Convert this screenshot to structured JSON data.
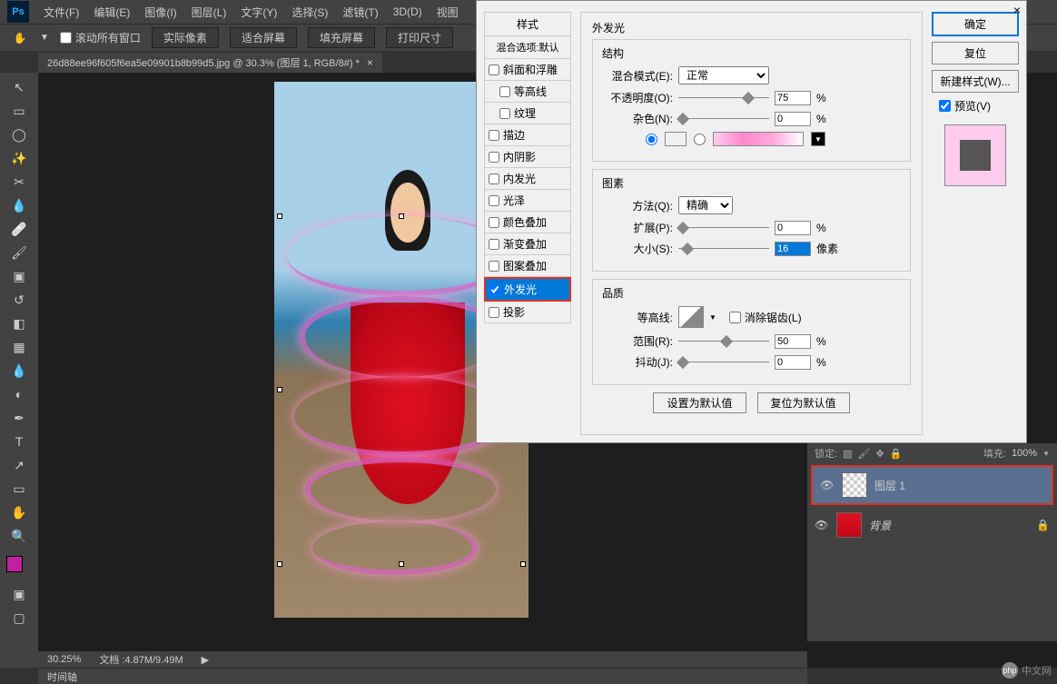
{
  "app": {
    "logo": "Ps"
  },
  "menu": {
    "file": "文件(F)",
    "edit": "编辑(E)",
    "image": "图像(I)",
    "layer": "图层(L)",
    "text": "文字(Y)",
    "select": "选择(S)",
    "filter": "滤镜(T)",
    "threed": "3D(D)",
    "view": "视图"
  },
  "options": {
    "scroll_all": "滚动所有窗口",
    "actual_pixels": "实际像素",
    "fit_screen": "适合屏幕",
    "fill_screen": "填充屏幕",
    "print_size": "打印尺寸"
  },
  "tab": {
    "filename": "26d88ee96f605f6ea5e09901b8b99d5.jpg @ 30.3% (图层 1, RGB/8#) *",
    "close": "×"
  },
  "status": {
    "zoom": "30.25%",
    "doc": "文档 :4.87M/9.49M"
  },
  "timeline": "时间轴",
  "layers": {
    "lock_label": "锁定:",
    "fill_label": "填充:",
    "fill_value": "100%",
    "layer1": "图层 1",
    "background": "背景"
  },
  "dialog": {
    "close": "×",
    "styles_header": "样式",
    "blend_default": "混合选项:默认",
    "bevel": "斜面和浮雕",
    "contour": "等高线",
    "texture": "纹理",
    "stroke": "描边",
    "inner_shadow": "内阴影",
    "inner_glow": "内发光",
    "satin": "光泽",
    "color_overlay": "颜色叠加",
    "gradient_overlay": "渐变叠加",
    "pattern_overlay": "图案叠加",
    "outer_glow": "外发光",
    "drop_shadow": "投影",
    "section_outer_glow": "外发光",
    "group_structure": "结构",
    "blend_mode": "混合模式(E):",
    "blend_mode_value": "正常",
    "opacity": "不透明度(O):",
    "opacity_value": "75",
    "noise": "杂色(N):",
    "noise_value": "0",
    "color_pink": "#ffb8e0",
    "group_elements": "图素",
    "technique": "方法(Q):",
    "technique_value": "精确",
    "spread": "扩展(P):",
    "spread_value": "0",
    "size": "大小(S):",
    "size_value": "16",
    "group_quality": "品质",
    "contour_label": "等高线:",
    "antialias": "消除锯齿(L)",
    "range": "范围(R):",
    "range_value": "50",
    "jitter": "抖动(J):",
    "jitter_value": "0",
    "set_default": "设置为默认值",
    "reset_default": "复位为默认值",
    "percent": "%",
    "pixels": "像素",
    "ok": "确定",
    "cancel": "复位",
    "new_style": "新建样式(W)...",
    "preview": "预览(V)"
  },
  "watermark": {
    "logo": "php",
    "text": "中文网"
  }
}
